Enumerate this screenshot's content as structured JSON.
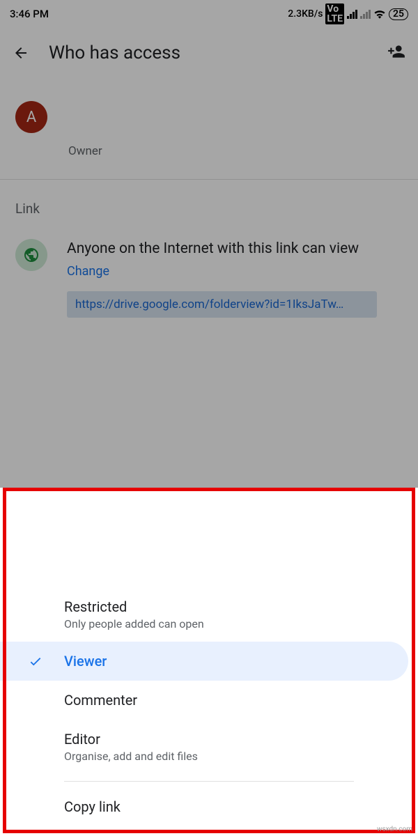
{
  "status_bar": {
    "time": "3:46 PM",
    "network_speed": "2.3KB/s",
    "battery": "25"
  },
  "header": {
    "title": "Who has access"
  },
  "owner": {
    "initial": "A",
    "role": "Owner"
  },
  "link_section": {
    "label": "Link",
    "description": "Anyone on the Internet with this link can view",
    "change": "Change",
    "url": "https://drive.google.com/folderview?id=1IksJaTw…"
  },
  "sheet": {
    "options": [
      {
        "title": "Restricted",
        "subtitle": "Only people added can open"
      },
      {
        "title": "Viewer",
        "subtitle": ""
      },
      {
        "title": "Commenter",
        "subtitle": ""
      },
      {
        "title": "Editor",
        "subtitle": "Organise, add and edit files"
      }
    ],
    "copy_link": "Copy link"
  },
  "watermark": "wsxdn.com"
}
